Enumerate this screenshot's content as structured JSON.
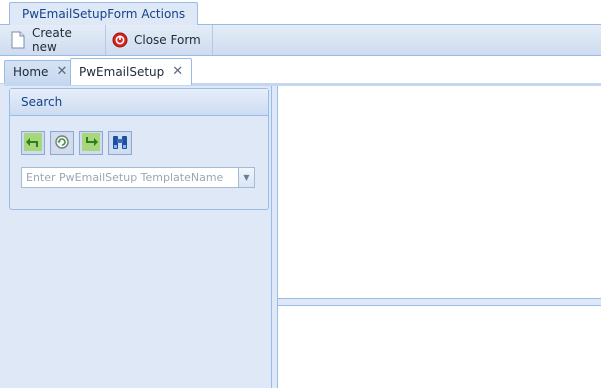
{
  "ribbon": {
    "tab_label": "PwEmailSetupForm Actions",
    "buttons": [
      {
        "label": "Create new",
        "icon": "new-document-icon"
      },
      {
        "label": "Close Form",
        "icon": "close-form-icon"
      }
    ]
  },
  "doc_tabs": [
    {
      "label": "Home",
      "active": false,
      "closable": true
    },
    {
      "label": "PwEmailSetup",
      "active": true,
      "closable": true
    }
  ],
  "search_panel": {
    "title": "Search",
    "tools": [
      "back-icon",
      "refresh-icon",
      "forward-icon",
      "binoculars-icon"
    ],
    "input_placeholder": "Enter PwEmailSetup TemplateName",
    "input_value": ""
  },
  "colors": {
    "panel_bg": "#dfe8f6",
    "border": "#99bbe8",
    "header_text": "#15428b"
  }
}
